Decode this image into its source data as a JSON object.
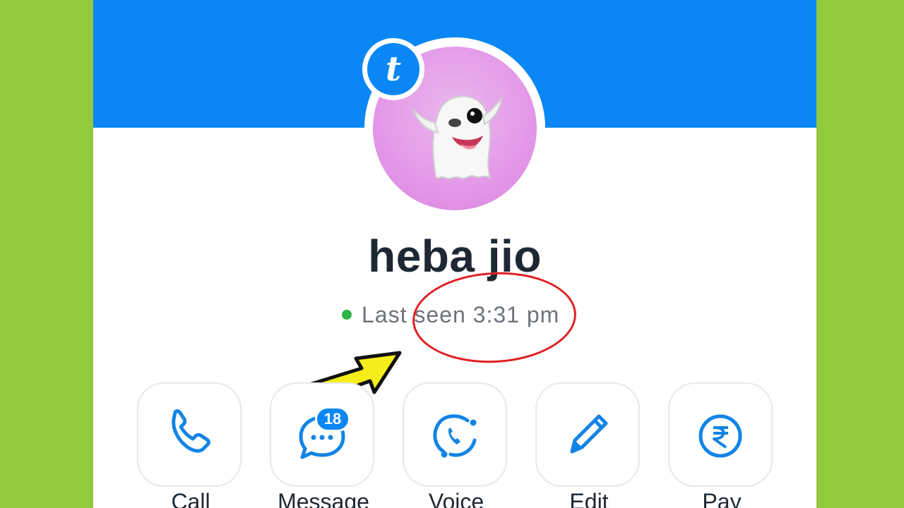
{
  "app": {
    "badge_letter": "t"
  },
  "profile": {
    "name": "heba jio",
    "status": "Last seen 3:31 pm",
    "avatar": "ghost-emoji"
  },
  "actions": [
    {
      "label": "Call",
      "icon": "phone-icon"
    },
    {
      "label": "Message",
      "icon": "message-icon",
      "badge": "18"
    },
    {
      "label": "Voice",
      "icon": "voice-icon"
    },
    {
      "label": "Edit",
      "icon": "pencil-icon"
    },
    {
      "label": "Pay",
      "icon": "rupee-icon"
    }
  ],
  "colors": {
    "accent": "#0a87f5",
    "online": "#2bb34a",
    "annotation_ellipse": "#e01f23",
    "annotation_arrow": "#f5ee1a",
    "backdrop": "#93c93d",
    "avatar_bg": "#e293e6"
  }
}
